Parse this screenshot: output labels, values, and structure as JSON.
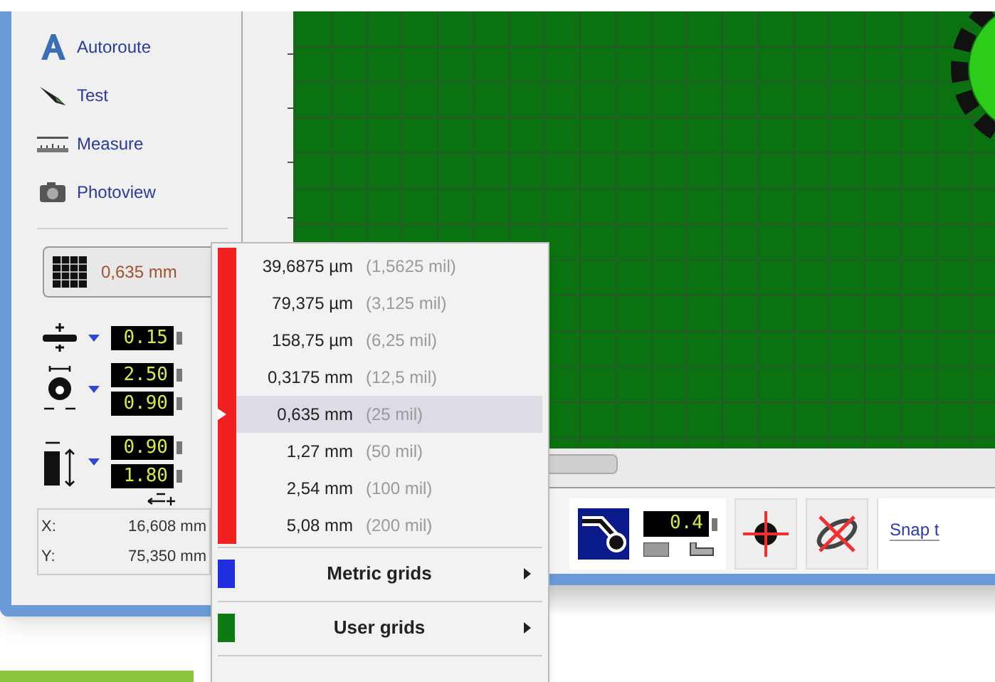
{
  "sidebar": {
    "tools": [
      {
        "kind": "autoroute",
        "label": "Autoroute"
      },
      {
        "kind": "test",
        "label": "Test"
      },
      {
        "kind": "measure",
        "label": "Measure"
      },
      {
        "kind": "photoview",
        "label": "Photoview"
      }
    ]
  },
  "grid_button": {
    "value": "0,635 mm"
  },
  "track_width": {
    "value": "0.15"
  },
  "pad": {
    "values": [
      "2.50",
      "0.90"
    ]
  },
  "smd_pad": {
    "values": [
      "0.90",
      "1.80"
    ]
  },
  "coordinates": [
    {
      "axis": "X:",
      "value": "16,608 mm"
    },
    {
      "axis": "Y:",
      "value": "75,350 mm"
    }
  ],
  "grid_menu": {
    "items": [
      {
        "value": "39,6875 µm",
        "mil": "(1,5625 mil)",
        "selected": false
      },
      {
        "value": "79,375 µm",
        "mil": "(3,125 mil)",
        "selected": false
      },
      {
        "value": "158,75 µm",
        "mil": "(6,25 mil)",
        "selected": false
      },
      {
        "value": "0,3175 mm",
        "mil": "(12,5 mil)",
        "selected": false
      },
      {
        "value": "0,635 mm",
        "mil": "(25 mil)",
        "selected": true
      },
      {
        "value": "1,27 mm",
        "mil": "(50 mil)",
        "selected": false
      },
      {
        "value": "2,54 mm",
        "mil": "(100 mil)",
        "selected": false
      },
      {
        "value": "5,08 mm",
        "mil": "(200 mil)",
        "selected": false
      }
    ],
    "submenus": [
      {
        "label": "Metric grids",
        "color": "#1f2fe0"
      },
      {
        "label": "User grids",
        "color": "#0e7a12"
      }
    ]
  },
  "toolbar": {
    "clearance": "0.4",
    "snap_label": "Snap t"
  }
}
